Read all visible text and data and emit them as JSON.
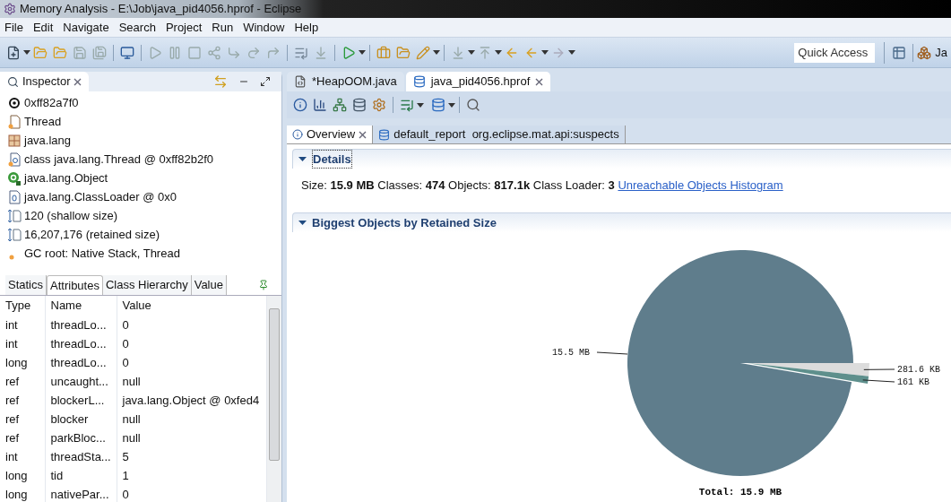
{
  "window": {
    "title": "Memory Analysis - E:\\Job\\java_pid4056.hprof - Eclipse"
  },
  "menu": [
    "File",
    "Edit",
    "Navigate",
    "Search",
    "Project",
    "Run",
    "Window",
    "Help"
  ],
  "quick_access": {
    "placeholder": "Quick Access"
  },
  "perspective": {
    "label": "Ja"
  },
  "inspector": {
    "title": "Inspector",
    "items": [
      {
        "kind": "address",
        "text": "0xff82a7f0"
      },
      {
        "kind": "class",
        "text": "Thread"
      },
      {
        "kind": "package",
        "text": "java.lang"
      },
      {
        "kind": "classfile",
        "text": "class java.lang.Thread @ 0xff82b2f0"
      },
      {
        "kind": "superclass",
        "text": "java.lang.Object"
      },
      {
        "kind": "loader",
        "text": "java.lang.ClassLoader @ 0x0"
      },
      {
        "kind": "size",
        "text": "120 (shallow size)"
      },
      {
        "kind": "size",
        "text": "16,207,176 (retained size)"
      },
      {
        "kind": "gcroot",
        "text": "GC root: Native Stack, Thread"
      }
    ]
  },
  "inspector_tabs": [
    {
      "label": "Statics",
      "selected": false
    },
    {
      "label": "Attributes",
      "selected": true
    },
    {
      "label": "Class Hierarchy",
      "selected": false
    },
    {
      "label": "Value",
      "selected": false
    }
  ],
  "attributes": {
    "columns": [
      "Type",
      "Name",
      "Value"
    ],
    "rows": [
      [
        "int",
        "threadLo...",
        "0"
      ],
      [
        "int",
        "threadLo...",
        "0"
      ],
      [
        "long",
        "threadLo...",
        "0"
      ],
      [
        "ref",
        "uncaught...",
        "null"
      ],
      [
        "ref",
        "blockerL...",
        "java.lang.Object @ 0xfed4"
      ],
      [
        "ref",
        "blocker",
        "null"
      ],
      [
        "ref",
        "parkBloc...",
        "null"
      ],
      [
        "int",
        "threadSta...",
        "5"
      ],
      [
        "long",
        "tid",
        "1"
      ],
      [
        "long",
        "nativePar...",
        "0"
      ]
    ]
  },
  "editor_tabs": [
    {
      "label": "*HeapOOM.java",
      "kind": "java",
      "selected": false
    },
    {
      "label": "java_pid4056.hprof",
      "kind": "heap",
      "selected": true
    }
  ],
  "sub_tabs": [
    {
      "label": "Overview",
      "kind": "info",
      "selected": true
    },
    {
      "label": "default_report  org.eclipse.mat.api:suspects",
      "kind": "report",
      "selected": false
    }
  ],
  "details": {
    "title": "Details",
    "text": "Size: **15.9 MB** Classes: **474** Objects: **817.1k** Class Loader: **3**",
    "link": "Unreachable Objects Histogram"
  },
  "biggest": {
    "title": "Biggest Objects by Retained Size",
    "chart_data": {
      "type": "pie",
      "title": "Total: 15.9 MB",
      "categories": [
        "15.5 MB",
        "281.6 KB",
        "161 KB"
      ],
      "values": [
        15872,
        281.6,
        161
      ],
      "colors": [
        "#5f7d8c",
        "#dcdcdc",
        "#5e8f8c"
      ]
    }
  }
}
